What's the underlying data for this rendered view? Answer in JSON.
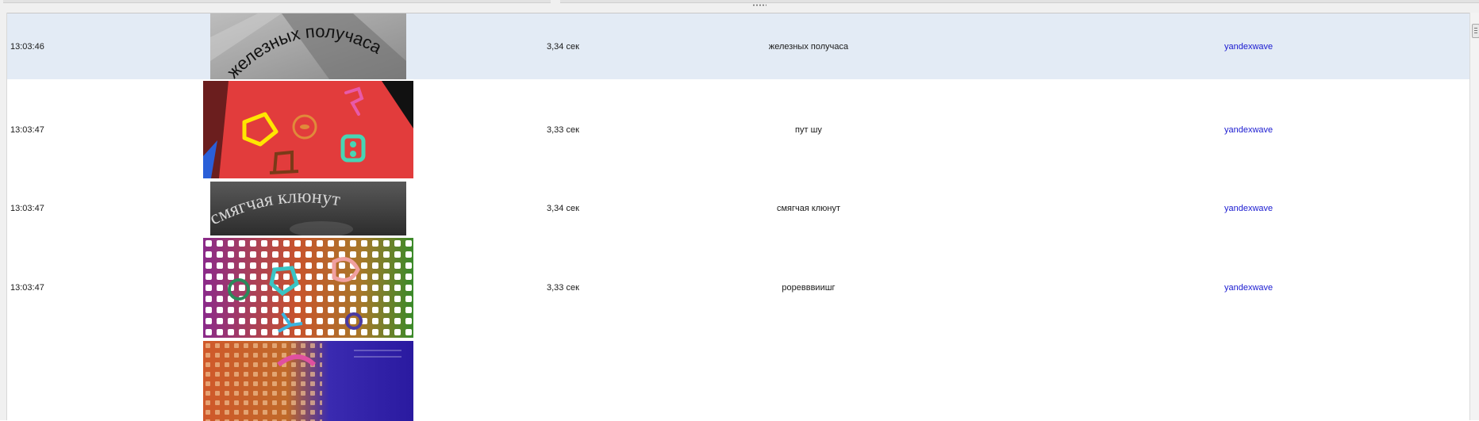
{
  "results": [
    {
      "time": "13:03:46",
      "duration": "3,34 сек",
      "answer": "железных получаса",
      "source": "yandexwave",
      "captcha_icon": "arched-text-captcha",
      "captcha_text": "железных получаса",
      "selected": true
    },
    {
      "time": "13:03:47",
      "duration": "3,33 сек",
      "answer": "пут  шу",
      "source": "yandexwave",
      "captcha_icon": "symbol-shapes-captcha"
    },
    {
      "time": "13:03:47",
      "duration": "3,34 сек",
      "answer": "смягчая клюнут",
      "source": "yandexwave",
      "captcha_icon": "arched-text-captcha-dark",
      "captcha_text": "смягчая клюнут"
    },
    {
      "time": "13:03:47",
      "duration": "3,33 сек",
      "answer": "роревввиишг",
      "source": "yandexwave",
      "captcha_icon": "dotted-symbols-captcha"
    }
  ],
  "colors": {
    "selection": "#e3ebf5",
    "link": "#1a1ad0",
    "captcha_red": "#e23c3c"
  }
}
